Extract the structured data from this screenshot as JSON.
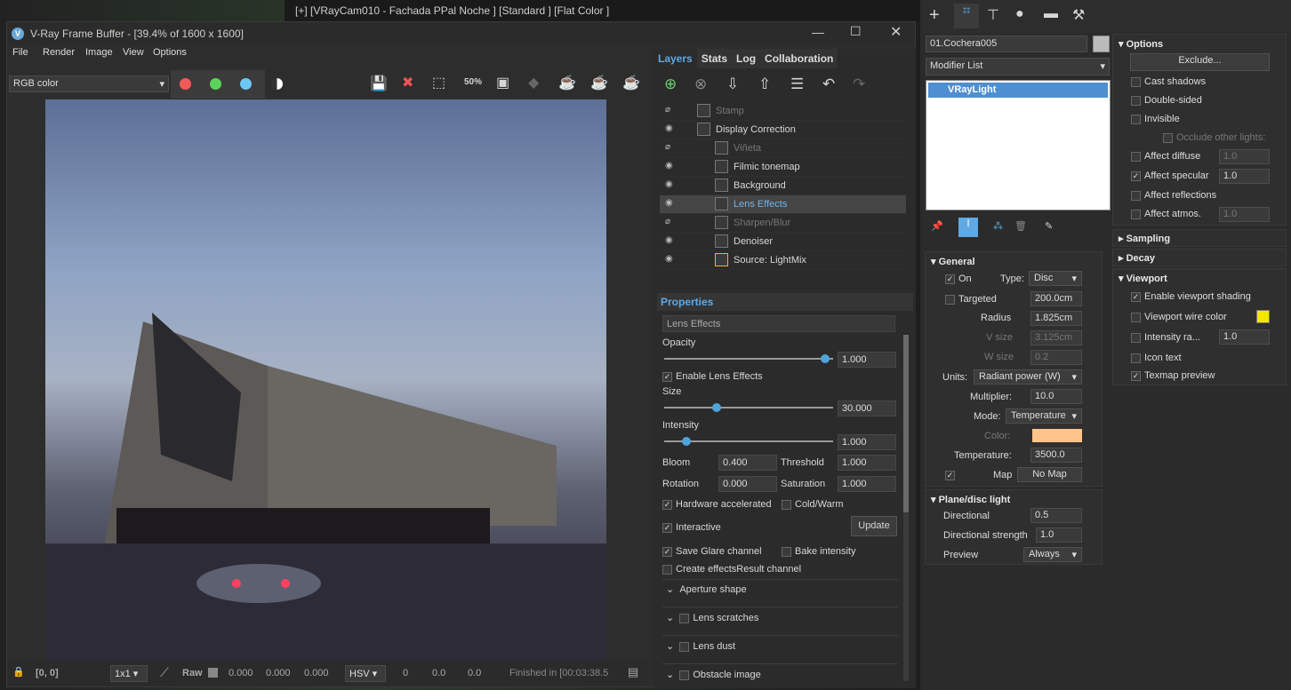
{
  "viewport": {
    "label": "[+] [VRayCam010 - Fachada PPal Noche ] [Standard ] [Flat Color ]"
  },
  "vfb": {
    "title": "V-Ray Frame Buffer - [39.4% of 1600 x 1600]",
    "menu": [
      "File",
      "Render",
      "Image",
      "View",
      "Options"
    ],
    "channel": "RGB color",
    "toolbar_zoom": "50%",
    "status": {
      "coords": "[0, 0]",
      "ratio": "1x1",
      "raw": "Raw",
      "v1": "0.000",
      "v2": "0.000",
      "v3": "0.000",
      "colorspace": "HSV",
      "h": "0",
      "s": "0.0",
      "v": "0.0",
      "finished": "Finished in [00:03:38.5"
    }
  },
  "layers_panel": {
    "tabs": [
      "Layers",
      "Stats",
      "Log",
      "Collaboration"
    ],
    "layers": [
      "Stamp",
      "Display Correction",
      "Viñeta",
      "Filmic tonemap",
      "Background",
      "Lens Effects",
      "Sharpen/Blur",
      "Denoiser",
      "Source: LightMix"
    ],
    "properties_title": "Properties",
    "selected_layer": "Lens Effects",
    "opacity_label": "Opacity",
    "opacity": "1.000",
    "opacity_level": 0.98,
    "enable_lens": "Enable Lens Effects",
    "size_label": "Size",
    "size": "30.000",
    "size_level": 0.3,
    "intensity_label": "Intensity",
    "intensity": "1.000",
    "intensity_level": 0.11,
    "bloom_label": "Bloom",
    "bloom": "0.400",
    "threshold_label": "Threshold",
    "threshold": "1.000",
    "rotation_label": "Rotation",
    "rotation": "0.000",
    "saturation_label": "Saturation",
    "saturation": "1.000",
    "hw_accel": "Hardware accelerated",
    "cold_warm": "Cold/Warm",
    "interactive": "Interactive",
    "update": "Update",
    "save_glare": "Save Glare channel",
    "bake": "Bake intensity",
    "create_effects": "Create effectsResult channel",
    "sections": [
      "Aperture shape",
      "Lens scratches",
      "Lens dust",
      "Obstacle image"
    ]
  },
  "cmd_panel": {
    "object_name": "01.Cochera005",
    "modifier_list": "Modifier List",
    "stack_item": "VRayLight",
    "general": {
      "title": "General",
      "on": "On",
      "type_label": "Type:",
      "type": "Disc",
      "targeted": "Targeted",
      "targeted_val": "200.0cm",
      "radius_label": "Radius",
      "radius": "1.825cm",
      "vsize_label": "V size",
      "vsize": "3.125cm",
      "wsize_label": "W size",
      "wsize": "0.2",
      "units_label": "Units:",
      "units": "Radiant power (W)",
      "multiplier_label": "Multiplier:",
      "multiplier": "10.0",
      "mode_label": "Mode:",
      "mode": "Temperature",
      "color_label": "Color:",
      "color": "#ffc48c",
      "temp_label": "Temperature:",
      "temp": "3500.0",
      "map_label": "Map",
      "map": "No Map"
    },
    "plane": {
      "title": "Plane/disc light",
      "directional_label": "Directional",
      "directional": "0.5",
      "dir_strength_label": "Directional strength",
      "dir_strength": "1.0",
      "preview_label": "Preview",
      "preview": "Always"
    },
    "options": {
      "title": "Options",
      "exclude": "Exclude...",
      "cast_shadows": "Cast shadows",
      "double_sided": "Double-sided",
      "invisible": "Invisible",
      "occlude": "Occlude other lights:",
      "affect_diffuse": "Affect diffuse",
      "affect_diffuse_val": "1.0",
      "affect_specular": "Affect specular",
      "affect_specular_val": "1.0",
      "affect_reflections": "Affect reflections",
      "affect_atmos": "Affect atmos.",
      "affect_atmos_val": "1.0"
    },
    "sampling": "Sampling",
    "decay": "Decay",
    "viewport": {
      "title": "Viewport",
      "enable_shading": "Enable viewport shading",
      "wire_color_label": "Viewport wire color",
      "wire_color": "#f5e600",
      "intensity_ra": "Intensity ra...",
      "intensity_ra_val": "1.0",
      "icon_text": "Icon text",
      "texmap_preview": "Texmap preview"
    }
  }
}
